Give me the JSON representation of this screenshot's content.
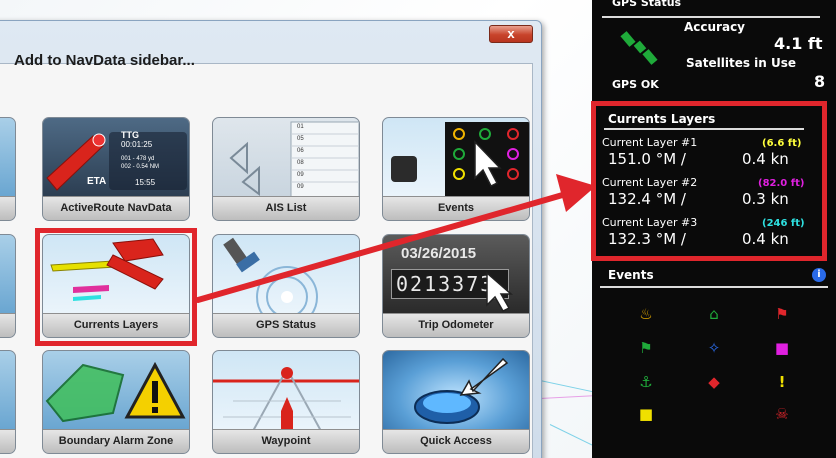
{
  "dialog": {
    "title": "Add to NavData sidebar...",
    "close_glyph": "x",
    "tiles": [
      {
        "label": "ActiveRoute NavData",
        "ttg_label": "TTG",
        "ttg_value": "00:01:25",
        "leg1": "001 - 478 yd",
        "leg2": "002 - 0.54 NM",
        "eta_label": "ETA",
        "eta_value": "15:55"
      },
      {
        "label": "AIS List",
        "rows": [
          "01",
          "05",
          "06",
          "08",
          "09",
          "09"
        ]
      },
      {
        "label": "Events"
      },
      {
        "label": "Currents Layers"
      },
      {
        "label": "GPS Status"
      },
      {
        "label": "Trip Odometer",
        "date": "03/26/2015",
        "digits": "0213373"
      },
      {
        "label": "Boundary Alarm Zone"
      },
      {
        "label": "Waypoint"
      },
      {
        "label": "Quick Access"
      }
    ]
  },
  "gps": {
    "header": "GPS Status",
    "accuracy_label": "Accuracy",
    "accuracy_value": "4.1 ft",
    "satellites_label": "Satellites in Use",
    "satellites_value": "8",
    "status": "GPS OK"
  },
  "currents": {
    "header": "Currents Layers",
    "layers": [
      {
        "name": "Current Layer #1",
        "depth": "(6.6 ft)",
        "depth_color": "#ffff3c",
        "bearing": "151.0 °M /",
        "speed": "0.4 kn"
      },
      {
        "name": "Current Layer #2",
        "depth": "(82.0 ft)",
        "depth_color": "#e020e0",
        "bearing": "132.4 °M /",
        "speed": "0.3 kn"
      },
      {
        "name": "Current Layer #3",
        "depth": "(246 ft)",
        "depth_color": "#2ee0e0",
        "bearing": "132.3 °M /",
        "speed": "0.4 kn"
      }
    ]
  },
  "events": {
    "header": "Events",
    "info_glyph": "i",
    "icons": [
      {
        "name": "restaurant-icon",
        "glyph": "♨",
        "color": "#f0b400"
      },
      {
        "name": "home-icon",
        "glyph": "⌂",
        "color": "#1faa3a"
      },
      {
        "name": "diver-icon",
        "glyph": "⚑",
        "color": "#e0262c"
      },
      {
        "name": "flag-icon",
        "glyph": "⚑",
        "color": "#1faa3a"
      },
      {
        "name": "fish-icon",
        "glyph": "✧",
        "color": "#2a6ae8"
      },
      {
        "name": "square-magenta-icon",
        "glyph": "■",
        "color": "#e020e0"
      },
      {
        "name": "anchor-icon",
        "glyph": "⚓",
        "color": "#1faa3a"
      },
      {
        "name": "diamond-icon",
        "glyph": "◆",
        "color": "#e0262c"
      },
      {
        "name": "exclamation-icon",
        "glyph": "!",
        "color": "#f0e000"
      },
      {
        "name": "square-yellow-icon",
        "glyph": "■",
        "color": "#f0e000"
      },
      {
        "name": "wreck-icon",
        "glyph": "☠",
        "color": "#e0262c"
      }
    ]
  },
  "colors": {
    "highlight": "#e0262c",
    "sidebar_bg": "#0a0a0a",
    "dialog_bg": "#dfe9f3"
  }
}
